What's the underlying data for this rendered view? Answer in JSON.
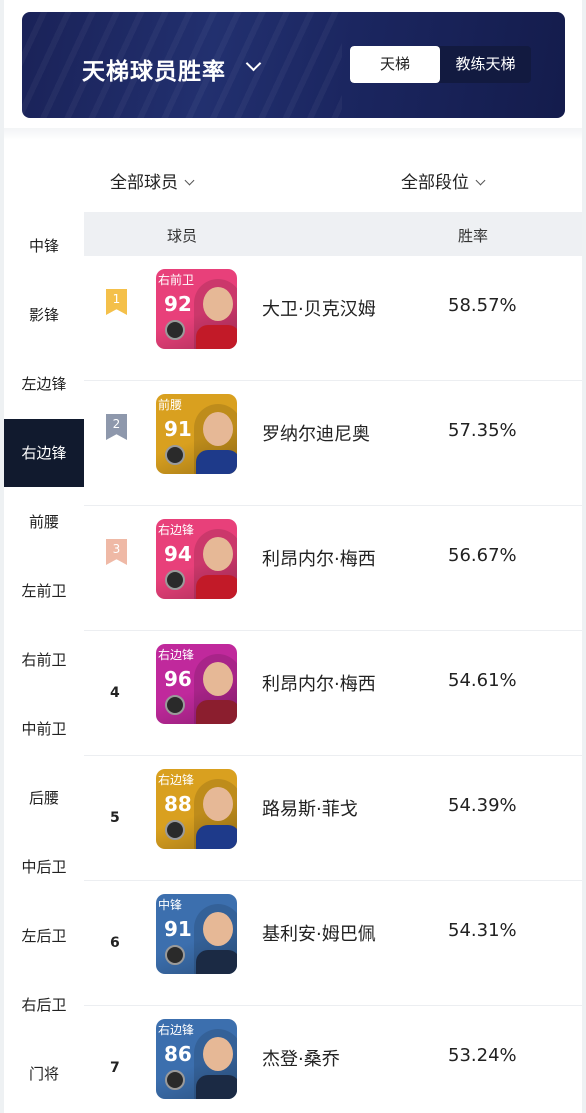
{
  "header": {
    "title": "天梯球员胜率",
    "tabs": [
      "天梯",
      "教练天梯"
    ],
    "active_tab": "天梯"
  },
  "filters": {
    "players": "全部球员",
    "tiers": "全部段位"
  },
  "table": {
    "col_player": "球员",
    "col_winrate": "胜率"
  },
  "sidebar": {
    "items": [
      "中锋",
      "影锋",
      "左边锋",
      "右边锋",
      "前腰",
      "左前卫",
      "右前卫",
      "中前卫",
      "后腰",
      "中后卫",
      "左后卫",
      "右后卫",
      "门将"
    ],
    "active": "右边锋"
  },
  "colors": {
    "rank1": "#f4c04a",
    "rank2": "#8e98ac",
    "rank3": "#efb9a6",
    "card_pink": "#e8407a",
    "card_gold": "#d9a01f",
    "card_magenta": "#c0299c",
    "card_blue": "#3c6fae"
  },
  "rows": [
    {
      "rank": "1",
      "position": "右前卫",
      "rating": "92",
      "name": "大卫·贝克汉姆",
      "winrate": "58.57%",
      "card": "card_pink"
    },
    {
      "rank": "2",
      "position": "前腰",
      "rating": "91",
      "name": "罗纳尔迪尼奥",
      "winrate": "57.35%",
      "card": "card_gold"
    },
    {
      "rank": "3",
      "position": "右边锋",
      "rating": "94",
      "name": "利昂内尔·梅西",
      "winrate": "56.67%",
      "card": "card_pink"
    },
    {
      "rank": "4",
      "position": "右边锋",
      "rating": "96",
      "name": "利昂内尔·梅西",
      "winrate": "54.61%",
      "card": "card_magenta"
    },
    {
      "rank": "5",
      "position": "右边锋",
      "rating": "88",
      "name": "路易斯·菲戈",
      "winrate": "54.39%",
      "card": "card_gold"
    },
    {
      "rank": "6",
      "position": "中锋",
      "rating": "91",
      "name": "基利安·姆巴佩",
      "winrate": "54.31%",
      "card": "card_blue"
    },
    {
      "rank": "7",
      "position": "右边锋",
      "rating": "86",
      "name": "杰登·桑乔",
      "winrate": "53.24%",
      "card": "card_blue"
    }
  ]
}
